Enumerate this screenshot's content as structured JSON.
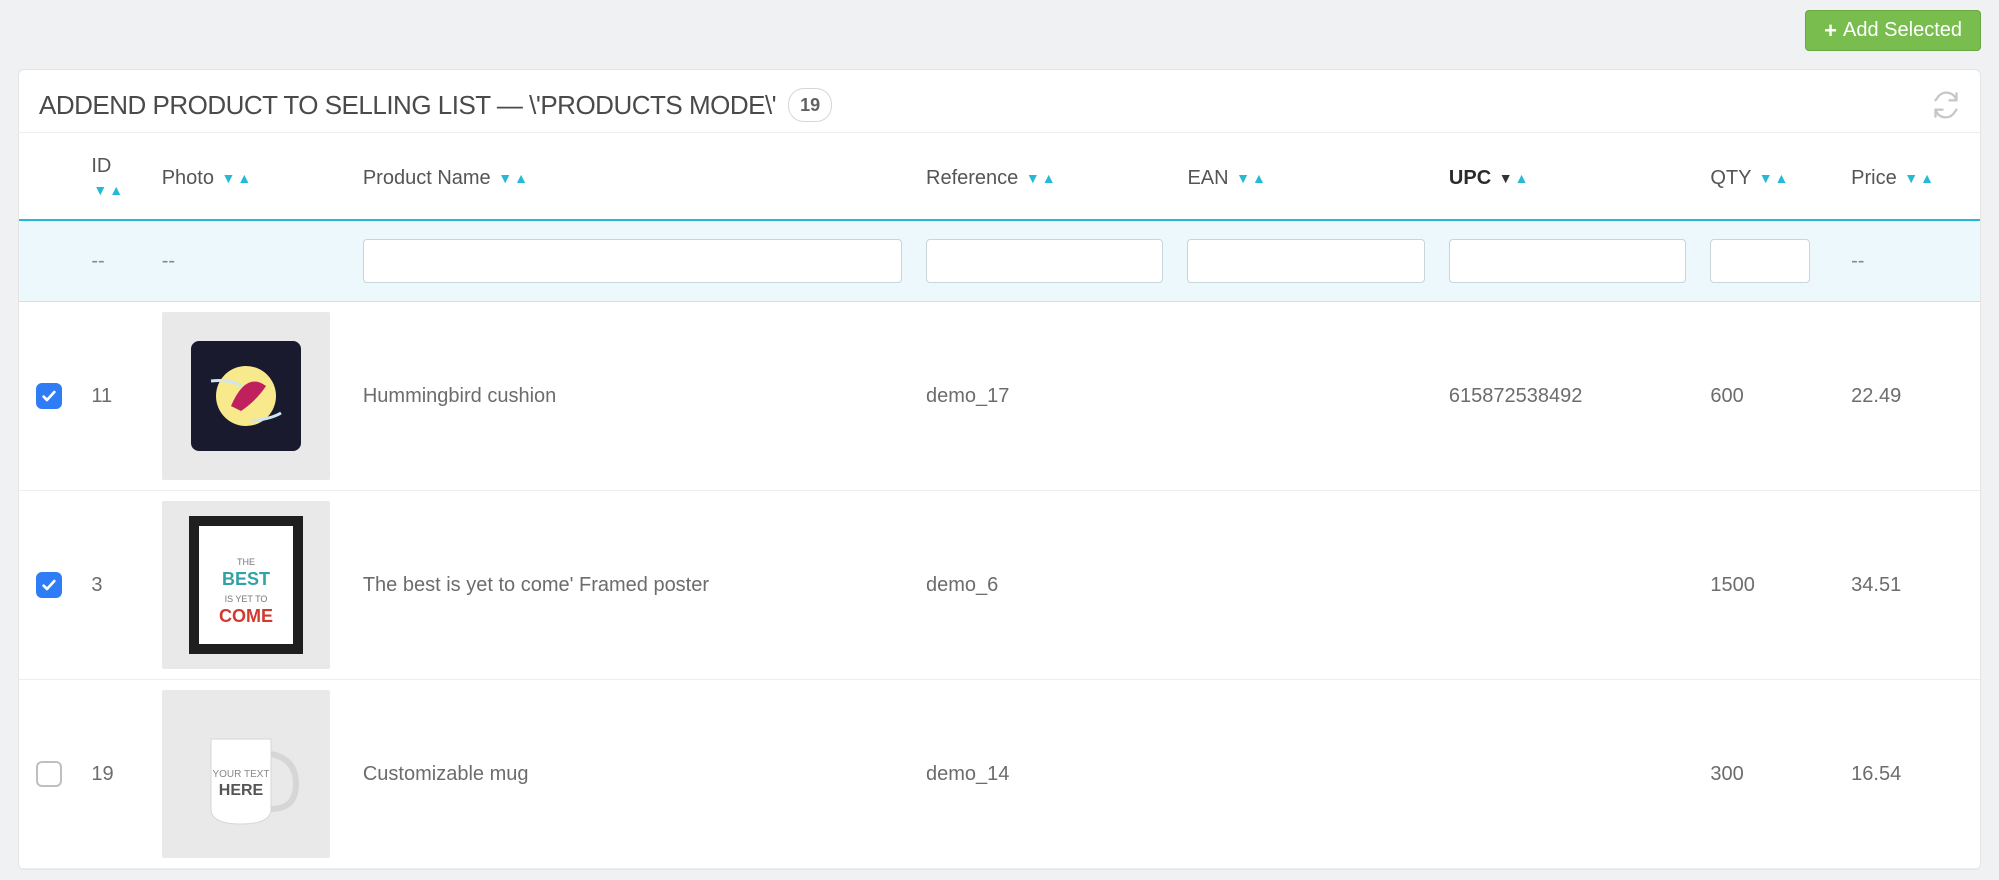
{
  "actions": {
    "add_selected_label": "Add Selected"
  },
  "header": {
    "title": "ADDEND PRODUCT TO SELLING LIST — \\'PRODUCTS MODE\\'",
    "count": "19"
  },
  "columns": {
    "id": "ID",
    "photo": "Photo",
    "product_name": "Product Name",
    "reference": "Reference",
    "ean": "EAN",
    "upc": "UPC",
    "qty": "QTY",
    "price": "Price"
  },
  "filters": {
    "id_placeholder": "--",
    "photo_placeholder": "--",
    "product_name": "",
    "reference": "",
    "ean": "",
    "upc": "",
    "qty": "",
    "price_placeholder": "--"
  },
  "rows": [
    {
      "checked": true,
      "id": "11",
      "product_name": "Hummingbird cushion",
      "reference": "demo_17",
      "ean": "",
      "upc": "615872538492",
      "qty": "600",
      "price": "22.49"
    },
    {
      "checked": true,
      "id": "3",
      "product_name": "The best is yet to come' Framed poster",
      "reference": "demo_6",
      "ean": "",
      "upc": "",
      "qty": "1500",
      "price": "34.51"
    },
    {
      "checked": false,
      "id": "19",
      "product_name": "Customizable mug",
      "reference": "demo_14",
      "ean": "",
      "upc": "",
      "qty": "300",
      "price": "16.54"
    }
  ]
}
